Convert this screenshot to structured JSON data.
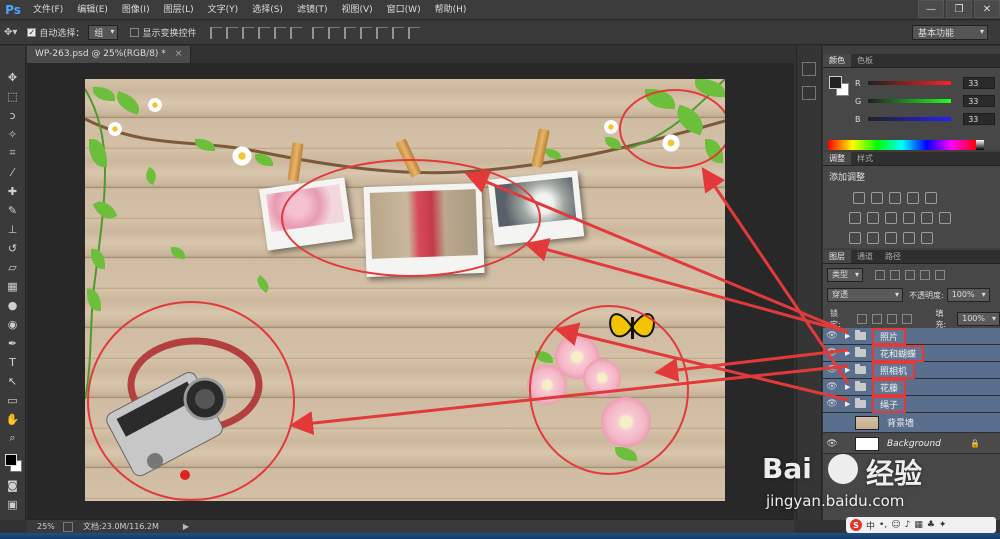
{
  "app": {
    "logo": "Ps"
  },
  "menu": [
    "文件(F)",
    "编辑(E)",
    "图像(I)",
    "图层(L)",
    "文字(Y)",
    "选择(S)",
    "滤镜(T)",
    "视图(V)",
    "窗口(W)",
    "帮助(H)"
  ],
  "window_controls": {
    "minimize": "—",
    "restore": "❐",
    "close": "✕"
  },
  "options": {
    "auto_select_label": "自动选择：",
    "auto_select_value": "组",
    "show_transform_label": "显示变换控件",
    "workspace": "基本功能"
  },
  "document": {
    "tab_title": "WP-263.psd @ 25%(RGB/8) *",
    "close": "×"
  },
  "status": {
    "zoom": "25%",
    "doc_size": "文档:23.0M/116.2M",
    "arrow": "▶"
  },
  "color_panel": {
    "tabs": [
      "颜色",
      "色板"
    ],
    "channels": [
      {
        "name": "R",
        "value": "33"
      },
      {
        "name": "G",
        "value": "33"
      },
      {
        "name": "B",
        "value": "33"
      }
    ]
  },
  "adjust_panel": {
    "tabs": [
      "调整",
      "样式"
    ],
    "title": "添加调整"
  },
  "layers_panel": {
    "tabs": [
      "图层",
      "通道",
      "路径"
    ],
    "filter_type": "类型",
    "blend_mode": "穿透",
    "opacity_label": "不透明度:",
    "opacity_value": "100%",
    "lock_label": "锁定:",
    "fill_label": "填充:",
    "fill_value": "100%",
    "layers": [
      {
        "name": "照片",
        "kind": "group"
      },
      {
        "name": "花和蝴蝶",
        "kind": "group"
      },
      {
        "name": "照相机",
        "kind": "group"
      },
      {
        "name": "花藤",
        "kind": "group"
      },
      {
        "name": "绳子",
        "kind": "group"
      },
      {
        "name": "背景墙",
        "kind": "layer"
      },
      {
        "name": "Background",
        "kind": "background"
      }
    ]
  },
  "watermark": {
    "brand": "Bai",
    "brand2": "经验",
    "url": "jingyan.baidu.com"
  },
  "ime": {
    "lang": "中"
  },
  "colors": {
    "accent_red": "#e23a3a",
    "selected_layer": "#5a6f8e"
  }
}
